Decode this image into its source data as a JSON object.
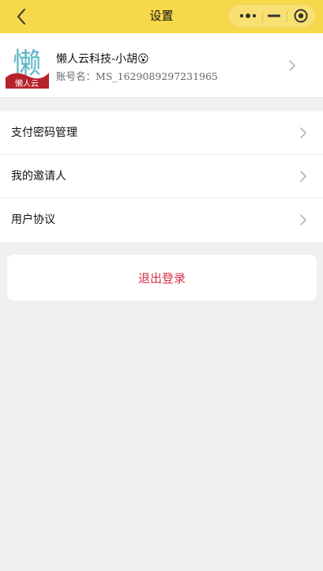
{
  "nav": {
    "title": "设置",
    "back_icon": "chevron-left-icon",
    "capsule_icons": [
      "more-dots-icon",
      "minimize-icon",
      "close-target-icon"
    ],
    "background": "#f7d84b"
  },
  "profile": {
    "name": "懒人云科技-小胡😮",
    "account_label": "账号名：",
    "account_value": "MS_1629089297231965",
    "avatar_text": "懒",
    "avatar_subtext": "懒人云"
  },
  "menu": {
    "items": [
      {
        "label": "支付密码管理"
      },
      {
        "label": "我的邀请人"
      },
      {
        "label": "用户协议"
      }
    ]
  },
  "logout": {
    "label": "退出登录",
    "color": "#d6304a"
  }
}
